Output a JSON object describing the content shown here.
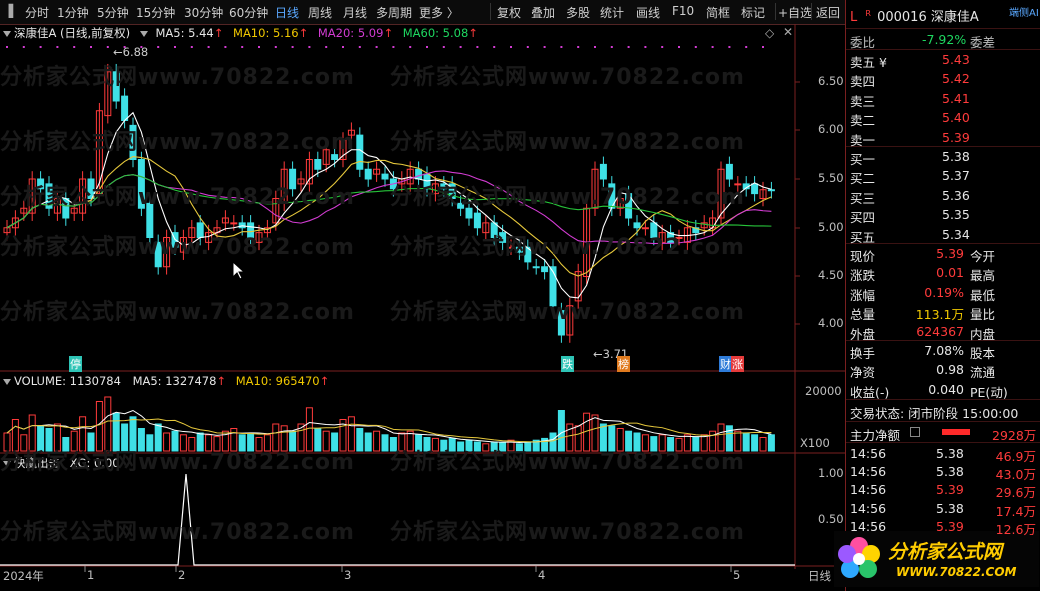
{
  "toolbar": {
    "items": [
      "分时",
      "1分钟",
      "5分钟",
      "15分钟",
      "30分钟",
      "60分钟",
      "日线",
      "周线",
      "月线",
      "多周期",
      "更多 〉",
      "复权",
      "叠加",
      "多股",
      "统计",
      "画线",
      "F10",
      "简框",
      "标记",
      "+自选",
      "返回"
    ],
    "active": "日线"
  },
  "main": {
    "title": "深康佳A (日线,前复权)",
    "ma5": "MA5: 5.44",
    "ma10": "MA10: 5.16",
    "ma20": "MA20: 5.09",
    "ma60": "MA60: 5.08",
    "high_note": "6.88",
    "low_note": "3.71",
    "y_ticks": [
      "6.50",
      "6.00",
      "5.50",
      "5.00",
      "4.50",
      "4.00"
    ],
    "markers": [
      "停",
      "跌",
      "榜",
      "财",
      "涨"
    ]
  },
  "volume": {
    "title": "VOLUME: 1130784",
    "ma5": "MA5: 1327478",
    "ma10": "MA10: 965470",
    "y_tick": "20000",
    "unit": "X100"
  },
  "indicator": {
    "title": "快赢出击",
    "xg": "XG: 0.00",
    "y_ticks": [
      "1.00",
      "0.50"
    ]
  },
  "x_axis": [
    "2024年",
    "1",
    "2",
    "3",
    "4",
    "5"
  ],
  "x_axis_right": "日线",
  "watermark": "分析家公式网www.70822.com",
  "colors": {
    "up": "#ff3b3b",
    "down": "#3fe0e6",
    "ma5": "#ffffff",
    "ma10": "#e6c83c",
    "ma20": "#d23cd2",
    "ma60": "#27c43a"
  },
  "panel": {
    "L": "L",
    "R": "R",
    "code_name": "000016 深康佳A",
    "tag": "端侧AI",
    "weibi_label": "委比",
    "weibi_value": "-7.92%",
    "weicha_label": "委差",
    "sell": [
      {
        "label": "卖五 ¥",
        "price": "5.43"
      },
      {
        "label": "卖四",
        "price": "5.42"
      },
      {
        "label": "卖三",
        "price": "5.41"
      },
      {
        "label": "卖二",
        "price": "5.40"
      },
      {
        "label": "卖一",
        "price": "5.39"
      }
    ],
    "buy": [
      {
        "label": "买一",
        "price": "5.38"
      },
      {
        "label": "买二",
        "price": "5.37"
      },
      {
        "label": "买三",
        "price": "5.36"
      },
      {
        "label": "买四",
        "price": "5.35"
      },
      {
        "label": "买五",
        "price": "5.34"
      }
    ],
    "quote": [
      {
        "label": "现价",
        "value": "5.39",
        "label2": "今开"
      },
      {
        "label": "涨跌",
        "value": "0.01",
        "label2": "最高"
      },
      {
        "label": "涨幅",
        "value": "0.19%",
        "label2": "最低"
      },
      {
        "label": "总量",
        "value": "113.1万",
        "label2": "量比"
      },
      {
        "label": "外盘",
        "value": "624367",
        "label2": "内盘"
      }
    ],
    "stats": [
      {
        "label": "换手",
        "value": "7.08%",
        "label2": "股本"
      },
      {
        "label": "净资",
        "value": "0.98",
        "label2": "流通"
      },
      {
        "label": "收益(-)",
        "value": "0.040",
        "label2": "PE(动)"
      }
    ],
    "status": "交易状态: 闭市阶段 15:00:00",
    "capital_label": "主力净额",
    "capital_value": "2928万",
    "ticks": [
      {
        "time": "14:56",
        "price": "5.38",
        "vol": "46.9万"
      },
      {
        "time": "14:56",
        "price": "5.38",
        "vol": "43.0万"
      },
      {
        "time": "14:56",
        "price": "5.39",
        "vol": "29.6万"
      },
      {
        "time": "14:56",
        "price": "5.38",
        "vol": "17.4万"
      },
      {
        "time": "14:56",
        "price": "5.39",
        "vol": "12.6万"
      }
    ],
    "logo_text": "分析家公式网",
    "logo_url": "WWW.70822.COM"
  }
}
